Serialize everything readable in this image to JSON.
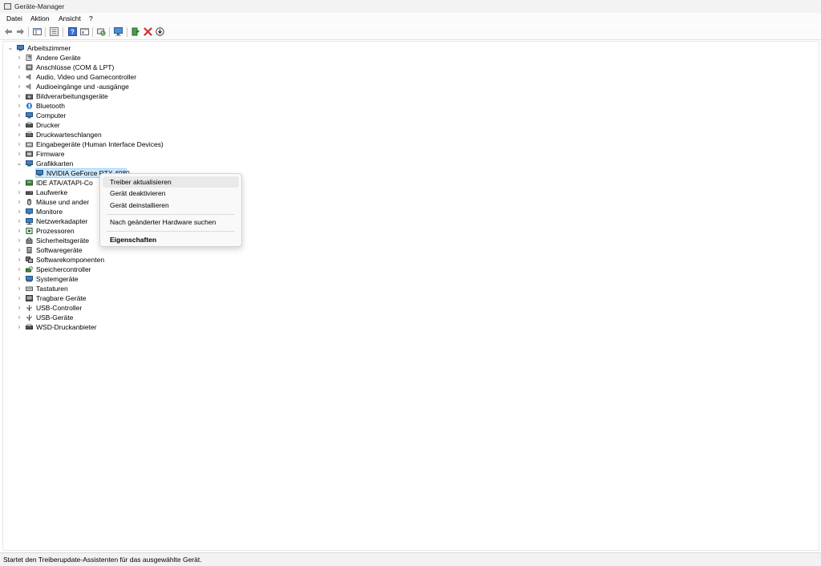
{
  "window": {
    "title": "Geräte-Manager"
  },
  "menu": {
    "items": [
      "Datei",
      "Aktion",
      "Ansicht",
      "?"
    ]
  },
  "toolbar": {
    "icons": [
      "back-arrow-icon",
      "forward-arrow-icon",
      "show-hide-console-tree-icon",
      "properties-icon",
      "help-icon",
      "view-icon",
      "scan-hardware-icon",
      "monitor-icon",
      "update-driver-icon",
      "uninstall-icon",
      "disable-device-icon"
    ]
  },
  "tree": {
    "root": "Arbeitszimmer",
    "categories": [
      "Andere Geräte",
      "Anschlüsse (COM & LPT)",
      "Audio, Video und Gamecontroller",
      "Audioeingänge und -ausgänge",
      "Bildverarbeitungsgeräte",
      "Bluetooth",
      "Computer",
      "Drucker",
      "Druckwarteschlangen",
      "Eingabegeräte (Human Interface Devices)",
      "Firmware",
      "Grafikkarten",
      "IDE ATA/ATAPI-Co",
      "Laufwerke",
      "Mäuse und ander",
      "Monitore",
      "Netzwerkadapter",
      "Prozessoren",
      "Sicherheitsgeräte",
      "Softwaregeräte",
      "Softwarekomponenten",
      "Speichercontroller",
      "Systemgeräte",
      "Tastaturen",
      "Tragbare Geräte",
      "USB-Controller",
      "USB-Geräte",
      "WSD-Druckanbieter"
    ],
    "expanded_child": "NVIDIA GeForce RTX 4080"
  },
  "context_menu": {
    "items": [
      "Treiber aktualisieren",
      "Gerät deaktivieren",
      "Gerät deinstallieren",
      "Nach geänderter Hardware suchen",
      "Eigenschaften"
    ]
  },
  "status": {
    "text": "Startet den Treiberupdate-Assistenten für das ausgewählte Gerät."
  },
  "colors": {
    "selection": "#cce8ff",
    "accent_blue": "#2b7de9",
    "delete_red": "#d0312d"
  }
}
